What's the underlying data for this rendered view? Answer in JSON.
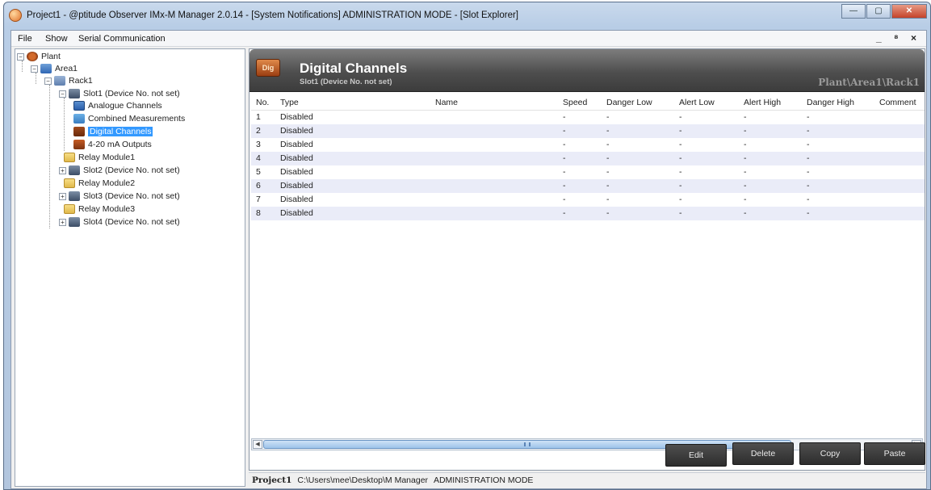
{
  "window": {
    "title": "Project1 - @ptitude Observer IMx-M Manager 2.0.14 - [System Notifications] ADMINISTRATION MODE - [Slot Explorer]",
    "minimize": "—",
    "maximize": "▢",
    "close": "✕"
  },
  "menu": {
    "file": "File",
    "show": "Show",
    "serial": "Serial Communication",
    "mdi_controls": "_ ⁸ ×"
  },
  "tree": {
    "plant": "Plant",
    "area": "Area1",
    "rack": "Rack1",
    "slot1": "Slot1 (Device No. not set)",
    "analogue": "Analogue Channels",
    "combined": "Combined Measurements",
    "digital": "Digital Channels",
    "outputs": "4-20 mA Outputs",
    "relay1": "Relay Module1",
    "slot2": "Slot2 (Device No. not set)",
    "relay2": "Relay Module2",
    "slot3": "Slot3 (Device No. not set)",
    "relay3": "Relay Module3",
    "slot4": "Slot4 (Device No. not set)",
    "selected": "Digital Channels"
  },
  "header": {
    "logo": "Dig",
    "title": "Digital Channels",
    "subtitle": "Slot1 (Device No. not set)",
    "path": "Plant\\Area1\\Rack1"
  },
  "grid": {
    "columns": [
      "No.",
      "Type",
      "Name",
      "Speed",
      "Danger Low",
      "Alert Low",
      "Alert High",
      "Danger High",
      "Comment"
    ],
    "rows": [
      {
        "no": "1",
        "type": "Disabled",
        "name": "",
        "speed": "-",
        "danger_low": "-",
        "alert_low": "-",
        "alert_high": "-",
        "danger_high": "-",
        "comment": ""
      },
      {
        "no": "2",
        "type": "Disabled",
        "name": "",
        "speed": "-",
        "danger_low": "-",
        "alert_low": "-",
        "alert_high": "-",
        "danger_high": "-",
        "comment": ""
      },
      {
        "no": "3",
        "type": "Disabled",
        "name": "",
        "speed": "-",
        "danger_low": "-",
        "alert_low": "-",
        "alert_high": "-",
        "danger_high": "-",
        "comment": ""
      },
      {
        "no": "4",
        "type": "Disabled",
        "name": "",
        "speed": "-",
        "danger_low": "-",
        "alert_low": "-",
        "alert_high": "-",
        "danger_high": "-",
        "comment": ""
      },
      {
        "no": "5",
        "type": "Disabled",
        "name": "",
        "speed": "-",
        "danger_low": "-",
        "alert_low": "-",
        "alert_high": "-",
        "danger_high": "-",
        "comment": ""
      },
      {
        "no": "6",
        "type": "Disabled",
        "name": "",
        "speed": "-",
        "danger_low": "-",
        "alert_low": "-",
        "alert_high": "-",
        "danger_high": "-",
        "comment": ""
      },
      {
        "no": "7",
        "type": "Disabled",
        "name": "",
        "speed": "-",
        "danger_low": "-",
        "alert_low": "-",
        "alert_high": "-",
        "danger_high": "-",
        "comment": ""
      },
      {
        "no": "8",
        "type": "Disabled",
        "name": "",
        "speed": "-",
        "danger_low": "-",
        "alert_low": "-",
        "alert_high": "-",
        "danger_high": "-",
        "comment": ""
      }
    ]
  },
  "buttons": {
    "edit": "Edit",
    "delete": "Delete",
    "copy": "Copy",
    "paste": "Paste"
  },
  "status": {
    "project": "Project1",
    "path": "C:\\Users\\mee\\Desktop\\M Manager",
    "mode": "ADMINISTRATION MODE"
  },
  "colors": {
    "selection": "#3399ff",
    "header_bg": "#4e4e4e",
    "alt_row": "#eaecf8",
    "button_bg": "#3a3a3a"
  },
  "icons": [
    "app-icon",
    "plant-icon",
    "area-icon",
    "rack-icon",
    "slot-icon",
    "analogue-channels-icon",
    "combined-measurements-icon",
    "digital-channels-icon",
    "outputs-icon",
    "relay-module-icon"
  ]
}
